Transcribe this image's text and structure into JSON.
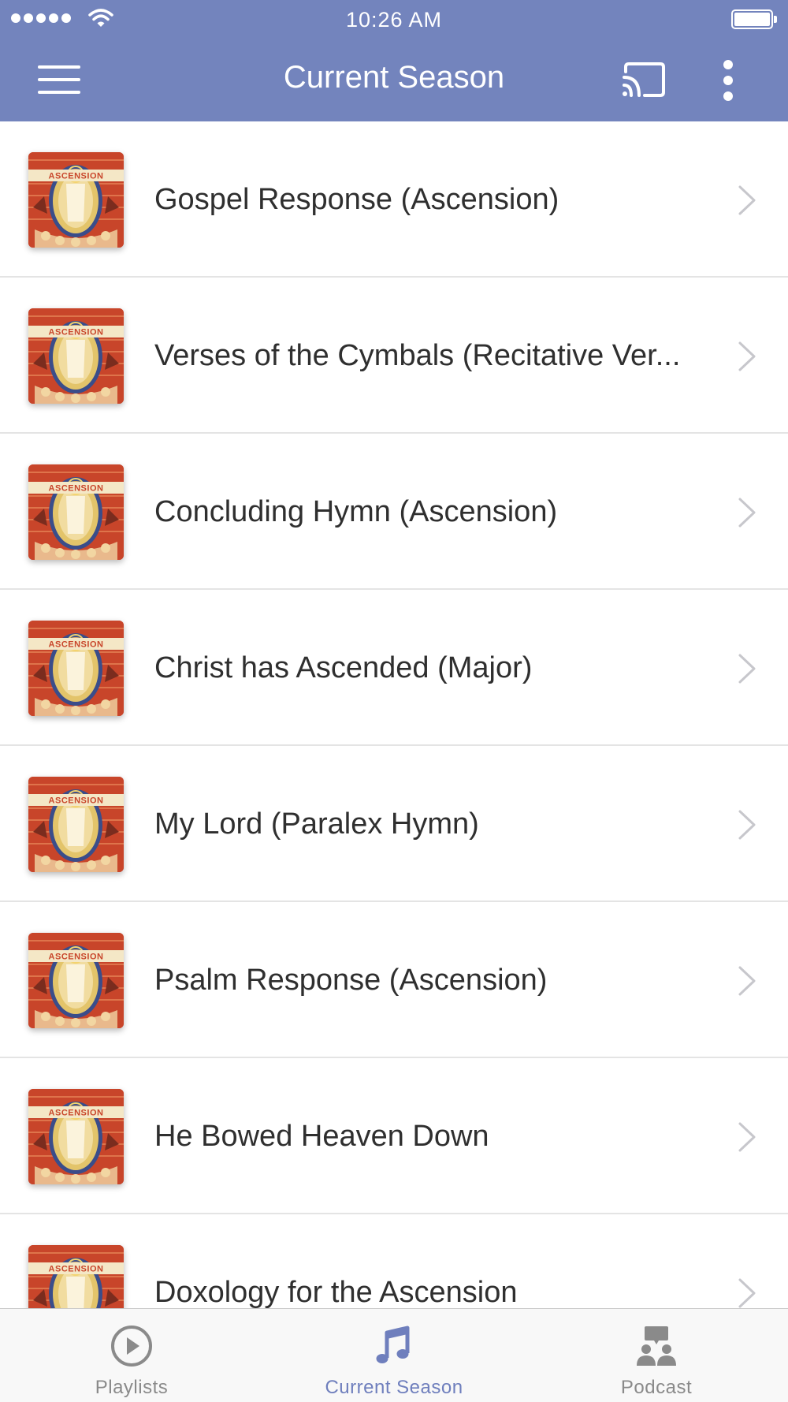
{
  "status_bar": {
    "time": "10:26 AM",
    "signal_icon": "signal-dots-icon",
    "wifi_icon": "wifi-icon",
    "battery_icon": "battery-icon",
    "battery_level": 1.0
  },
  "nav": {
    "title": "Current Season",
    "menu_icon": "hamburger-menu-icon",
    "cast_icon": "cast-icon",
    "more_icon": "more-vertical-icon"
  },
  "colors": {
    "header_bg": "#7384bd",
    "tab_active": "#6f7fbd",
    "tab_inactive": "#8a8a8a",
    "thumb_bg": "#c8452a"
  },
  "thumbnail_label": "ASCENSION",
  "items": [
    {
      "title": "Gospel Response (Ascension)"
    },
    {
      "title": "Verses of the Cymbals (Recitative Ver..."
    },
    {
      "title": "Concluding Hymn (Ascension)"
    },
    {
      "title": "Christ has Ascended (Major)"
    },
    {
      "title": "My Lord (Paralex Hymn)"
    },
    {
      "title": "Psalm Response (Ascension)"
    },
    {
      "title": "He Bowed Heaven Down"
    },
    {
      "title": "Doxology for the Ascension"
    }
  ],
  "tabs": [
    {
      "label": "Playlists",
      "icon": "play-circle-icon",
      "active": false
    },
    {
      "label": "Current Season",
      "icon": "music-note-icon",
      "active": true
    },
    {
      "label": "Podcast",
      "icon": "people-board-icon",
      "active": false
    }
  ]
}
